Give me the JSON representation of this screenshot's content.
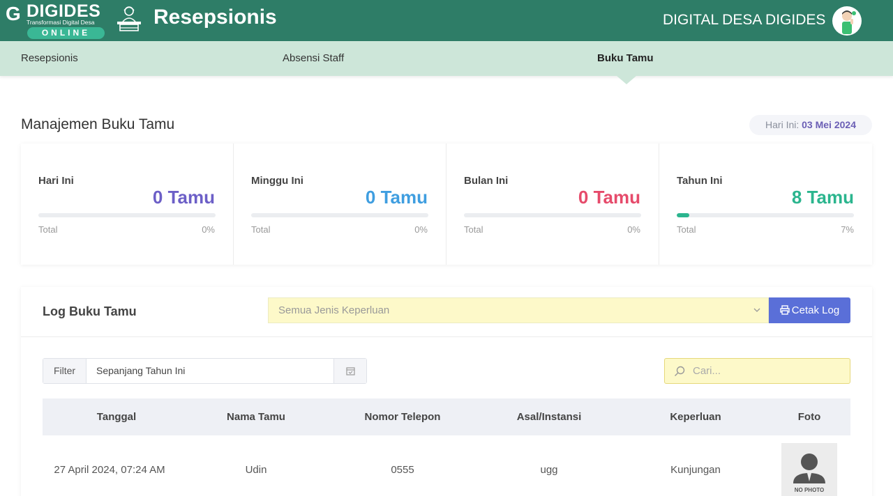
{
  "header": {
    "logo_letter": "G",
    "logo_name": "DIGIDES",
    "logo_tagline": "Transformasi Digital Desa",
    "logo_badge": "ONLINE",
    "app_title": "Resepsionis",
    "org_name": "DIGITAL DESA DIGIDES"
  },
  "nav": {
    "items": [
      {
        "label": "Resepsionis"
      },
      {
        "label": "Absensi Staff"
      },
      {
        "label": "Buku Tamu",
        "active": true
      }
    ]
  },
  "page": {
    "title": "Manajemen Buku Tamu",
    "date_label": "Hari Ini:",
    "date_value": "03 Mei 2024"
  },
  "stats": [
    {
      "label": "Hari Ini",
      "value": "0 Tamu",
      "total_label": "Total",
      "pct_label": "0%",
      "progress": 0,
      "color": "#6c5fc7"
    },
    {
      "label": "Minggu Ini",
      "value": "0 Tamu",
      "total_label": "Total",
      "pct_label": "0%",
      "progress": 0,
      "color": "#3f9ee0"
    },
    {
      "label": "Bulan Ini",
      "value": "0 Tamu",
      "total_label": "Total",
      "pct_label": "0%",
      "progress": 0,
      "color": "#e64b6b"
    },
    {
      "label": "Tahun Ini",
      "value": "8 Tamu",
      "total_label": "Total",
      "pct_label": "7%",
      "progress": 0.07,
      "color": "#2bb58e"
    }
  ],
  "log": {
    "title": "Log Buku Tamu",
    "purpose_select": "Semua Jenis Keperluan",
    "print_label": "Cetak Log",
    "filter_label": "Filter",
    "filter_value": "Sepanjang Tahun Ini",
    "search_placeholder": "Cari...",
    "columns": [
      "Tanggal",
      "Nama Tamu",
      "Nomor Telepon",
      "Asal/Instansi",
      "Keperluan",
      "Foto"
    ],
    "rows": [
      [
        "27 April 2024, 07:24 AM",
        "Udin",
        "0555",
        "ugg",
        "Kunjungan",
        "NO PHOTO"
      ]
    ]
  },
  "colors": {
    "header_bg": "#2e7d67",
    "nav_bg": "#cde6d9",
    "primary_button": "#5a6fd8",
    "input_highlight": "#fdf9c9"
  },
  "icons": [
    "recepsionist-icon",
    "avatar-icon",
    "print-icon",
    "calendar-icon",
    "search-icon",
    "chevron-down-icon",
    "no-photo-icon"
  ]
}
